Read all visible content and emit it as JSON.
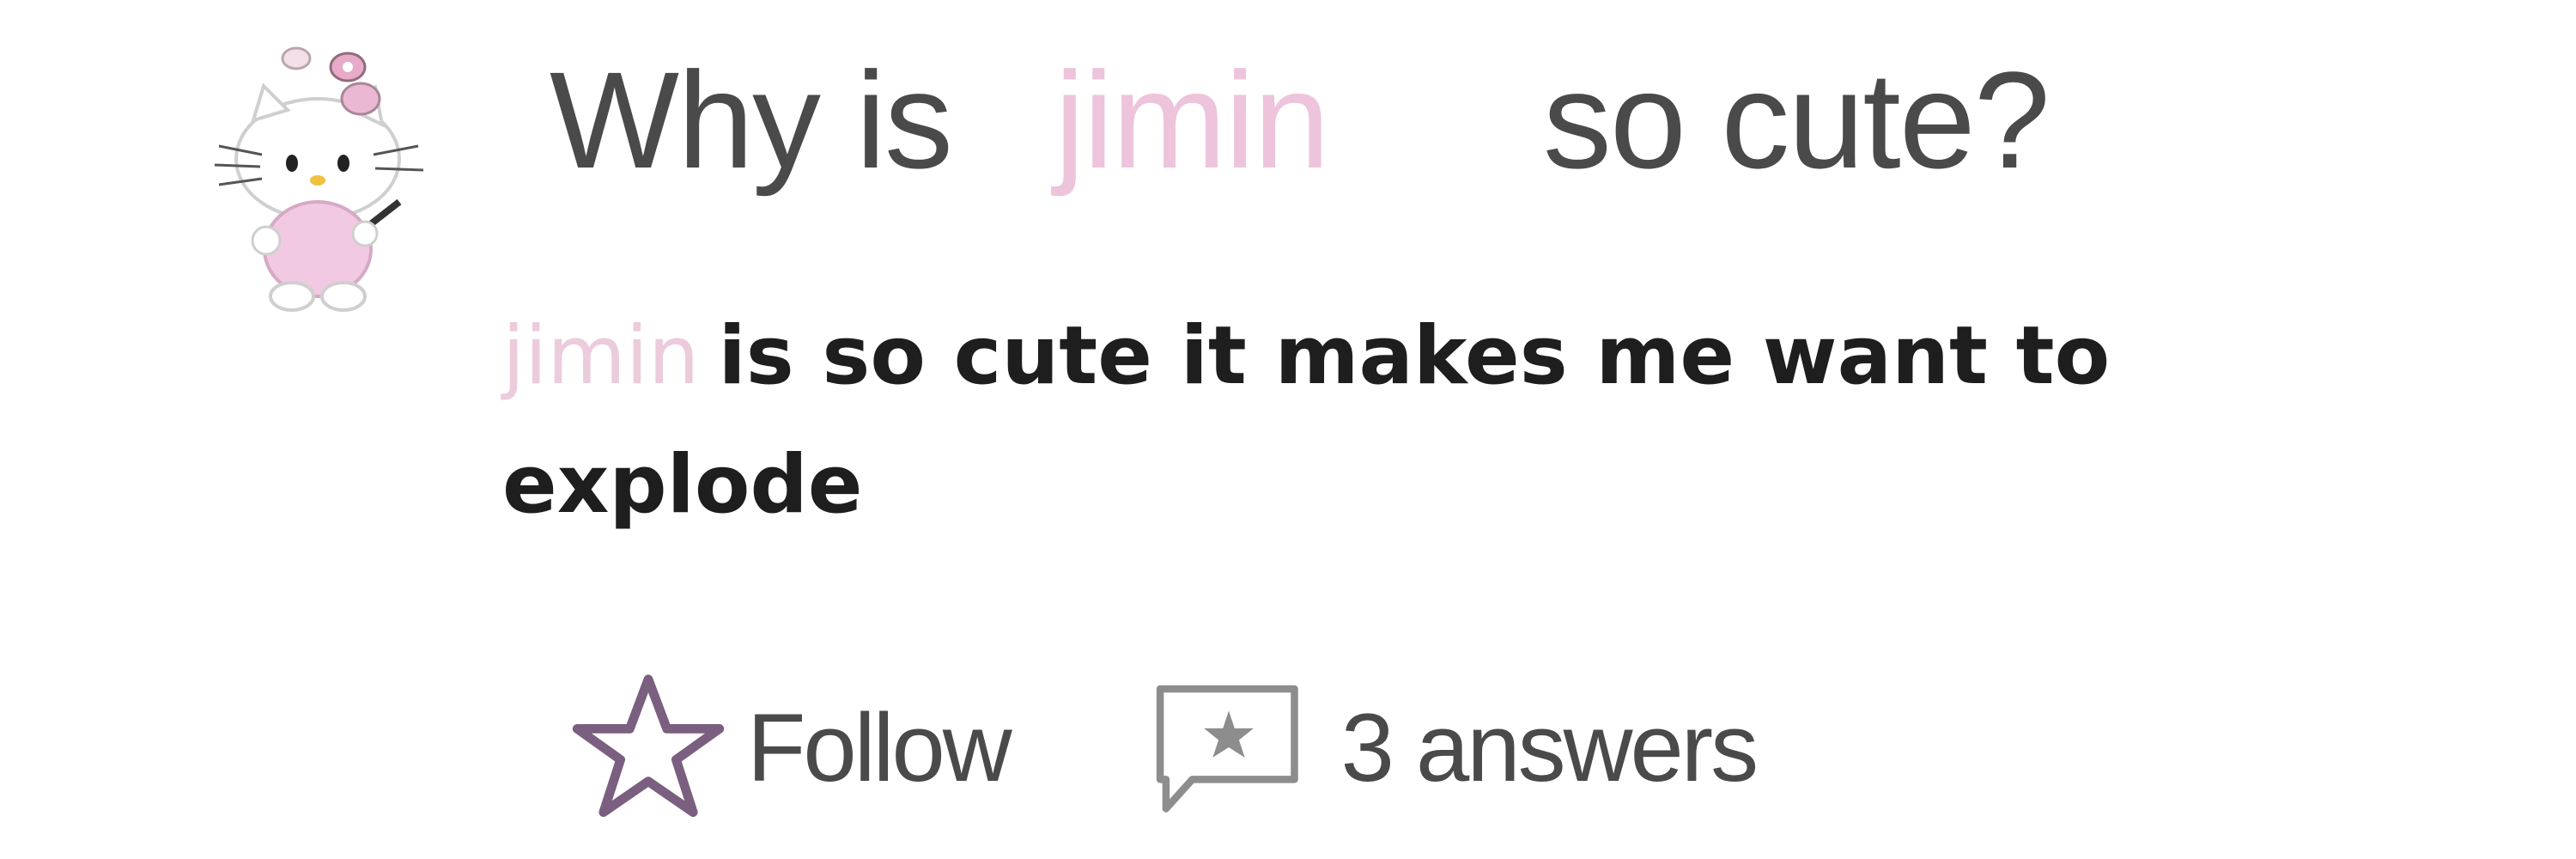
{
  "question": {
    "prefix": "Why is",
    "highlight": "jimin",
    "suffix": "so cute?"
  },
  "answer": {
    "highlight": "jimin",
    "text": "is so cute it makes me want to explode"
  },
  "actions": {
    "follow_label": "Follow",
    "answers_label": "3 answers"
  },
  "colors": {
    "highlight": "#edc4dc",
    "icon_purple": "#7a5f80",
    "text": "#4a4a4a"
  },
  "icons": [
    "hello-kitty-avatar",
    "star-icon",
    "answer-icon"
  ]
}
